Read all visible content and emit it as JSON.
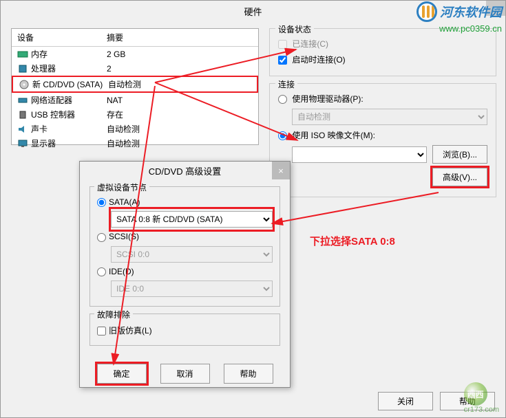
{
  "main": {
    "title": "硬件",
    "dev_header": {
      "device": "设备",
      "summary": "摘要"
    },
    "devices": [
      {
        "name": "内存",
        "summary": "2 GB"
      },
      {
        "name": "处理器",
        "summary": "2"
      },
      {
        "name": "新 CD/DVD (SATA)",
        "summary": "自动检测"
      },
      {
        "name": "网络适配器",
        "summary": "NAT"
      },
      {
        "name": "USB 控制器",
        "summary": "存在"
      },
      {
        "name": "声卡",
        "summary": "自动检测"
      },
      {
        "name": "显示器",
        "summary": "自动检测"
      }
    ],
    "status": {
      "title": "设备状态",
      "connected": "已连接(C)",
      "connect_on_start": "启动时连接(O)"
    },
    "connection": {
      "title": "连接",
      "physical": "使用物理驱动器(P):",
      "auto_detect": "自动检测",
      "iso": "使用 ISO 映像文件(M):",
      "browse": "浏览(B)...",
      "advanced": "高级(V)..."
    },
    "footer": {
      "close": "关闭",
      "help": "帮助"
    }
  },
  "adv": {
    "title": "CD/DVD 高级设置",
    "group1": {
      "title": "虚拟设备节点",
      "sata": "SATA(A)",
      "sata_sel": "SATA 0:8  新 CD/DVD (SATA)",
      "scsi": "SCSI(S)",
      "scsi_sel": "SCSI 0:0",
      "ide": "IDE(D)",
      "ide_sel": "IDE 0:0"
    },
    "group2": {
      "title": "故障排除",
      "legacy": "旧版仿真(L)"
    },
    "buttons": {
      "ok": "确定",
      "cancel": "取消",
      "help": "帮助"
    }
  },
  "annot": {
    "text1": "下拉选择SATA 0:8"
  },
  "watermark": {
    "name": "河东软件园",
    "url": "www.pc0359.cn"
  },
  "bm": {
    "label": "西西",
    "sub": "cr173.com"
  }
}
